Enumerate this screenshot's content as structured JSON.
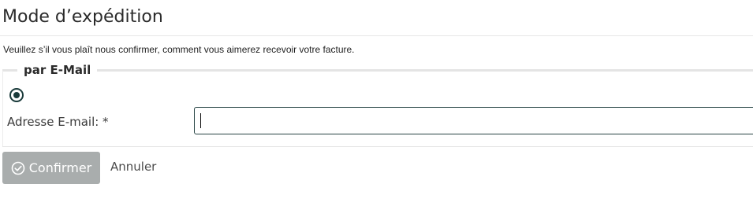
{
  "header": {
    "title": "Mode d’expédition"
  },
  "intro": {
    "text": "Veuillez s’il vous plaît nous confirmer, comment vous aimerez recevoir votre facture."
  },
  "email_option": {
    "legend": "par E-Mail",
    "radio_selected": true,
    "field_label": "Adresse E-mail: *",
    "field_value": "",
    "field_placeholder": ""
  },
  "actions": {
    "confirm_label": "Confirmer",
    "confirm_icon": "check-circle-icon",
    "cancel_label": "Annuler"
  },
  "colors": {
    "accent": "#1a3a3a",
    "button_disabled": "#a9adad",
    "input_border": "#274444"
  }
}
